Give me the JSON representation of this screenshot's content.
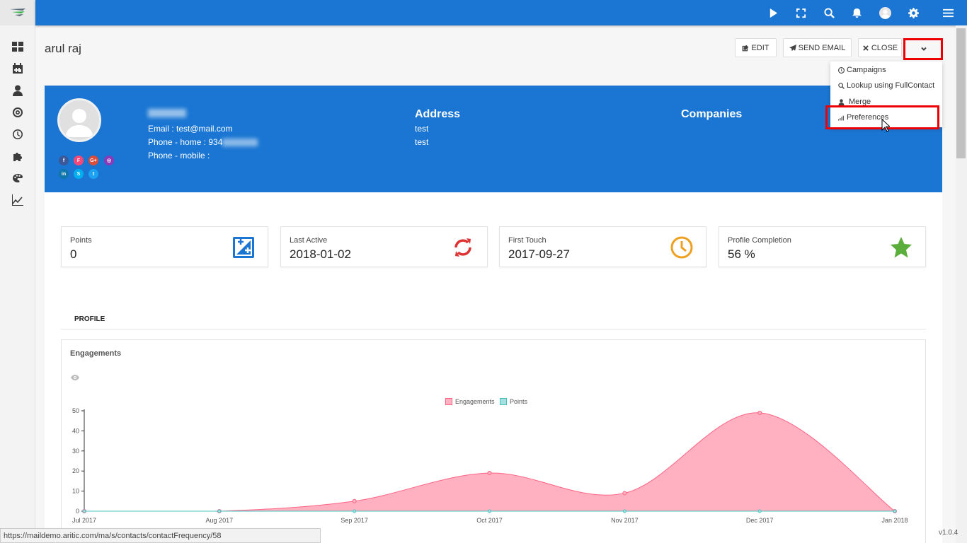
{
  "app": {
    "version": "v1.0.4"
  },
  "sidebar": {
    "items": [
      {
        "icon": "dashboard-icon"
      },
      {
        "icon": "calendar-icon"
      },
      {
        "icon": "user-icon"
      },
      {
        "icon": "target-icon"
      },
      {
        "icon": "clock-icon"
      },
      {
        "icon": "puzzle-icon"
      },
      {
        "icon": "palette-icon"
      },
      {
        "icon": "chart-line-icon"
      }
    ]
  },
  "topbar": {
    "icons": [
      "play-icon",
      "fullscreen-icon",
      "search-icon",
      "bell-icon",
      "avatar-icon",
      "gear-icon",
      "menu-icon"
    ]
  },
  "header": {
    "contact_name": "arul raj",
    "edit_label": "EDIT",
    "send_email_label": "SEND EMAIL",
    "close_label": "CLOSE"
  },
  "dropdown": {
    "items": [
      {
        "label": "Campaigns",
        "icon": "clock-icon"
      },
      {
        "label": "Lookup using FullContact",
        "icon": "search-icon"
      },
      {
        "label": "Merge",
        "icon": "user-icon"
      },
      {
        "label": "Preferences",
        "icon": "signal-icon"
      }
    ]
  },
  "profile": {
    "email_line": "Email : test@mail.com",
    "phone_home_prefix": "Phone - home : 934",
    "phone_mobile_line": "Phone - mobile :",
    "address_title": "Address",
    "address_lines": [
      "test",
      "test"
    ],
    "companies_title": "Companies",
    "social": [
      {
        "icon": "facebook-icon",
        "color": "#3b5998",
        "glyph": "f"
      },
      {
        "icon": "foursquare-icon",
        "color": "#f94877",
        "glyph": "F"
      },
      {
        "icon": "googleplus-icon",
        "color": "#dd4b39",
        "glyph": "G+"
      },
      {
        "icon": "instagram-icon",
        "color": "#8a3ab9",
        "glyph": "◎"
      },
      {
        "icon": "linkedin-icon",
        "color": "#0e76a8",
        "glyph": "in"
      },
      {
        "icon": "skype-icon",
        "color": "#00aff0",
        "glyph": "S"
      },
      {
        "icon": "twitter-icon",
        "color": "#1da1f2",
        "glyph": "t"
      }
    ]
  },
  "stats": [
    {
      "label": "Points",
      "value": "0",
      "icon": "edit-square-icon",
      "color": "#1a76d2"
    },
    {
      "label": "Last Active",
      "value": "2018-01-02",
      "icon": "refresh-icon",
      "color": "#d33"
    },
    {
      "label": "First Touch",
      "value": "2017-09-27",
      "icon": "clock-icon",
      "color": "#f0a020"
    },
    {
      "label": "Profile Completion",
      "value": "56 %",
      "icon": "star-icon",
      "color": "#5cae3c"
    }
  ],
  "tabs": {
    "profile_label": "PROFILE"
  },
  "chart_data": {
    "type": "area",
    "title": "Engagements",
    "categories": [
      "Jul 2017",
      "Aug 2017",
      "Sep 2017",
      "Oct 2017",
      "Nov 2017",
      "Dec 2017",
      "Jan 2018"
    ],
    "series": [
      {
        "name": "Engagements",
        "values": [
          0,
          0,
          5,
          19,
          9,
          49,
          0
        ],
        "color": "#ff6384"
      },
      {
        "name": "Points",
        "values": [
          0,
          0,
          0,
          0,
          0,
          0,
          0
        ],
        "color": "#4bc0c0"
      }
    ],
    "yticks": [
      "0",
      "10",
      "20",
      "30",
      "40",
      "50"
    ],
    "ylim": [
      0,
      50
    ],
    "legend": "top-center"
  },
  "statusbar": {
    "url": "https://maildemo.aritic.com/ma/s/contacts/contactFrequency/58"
  }
}
